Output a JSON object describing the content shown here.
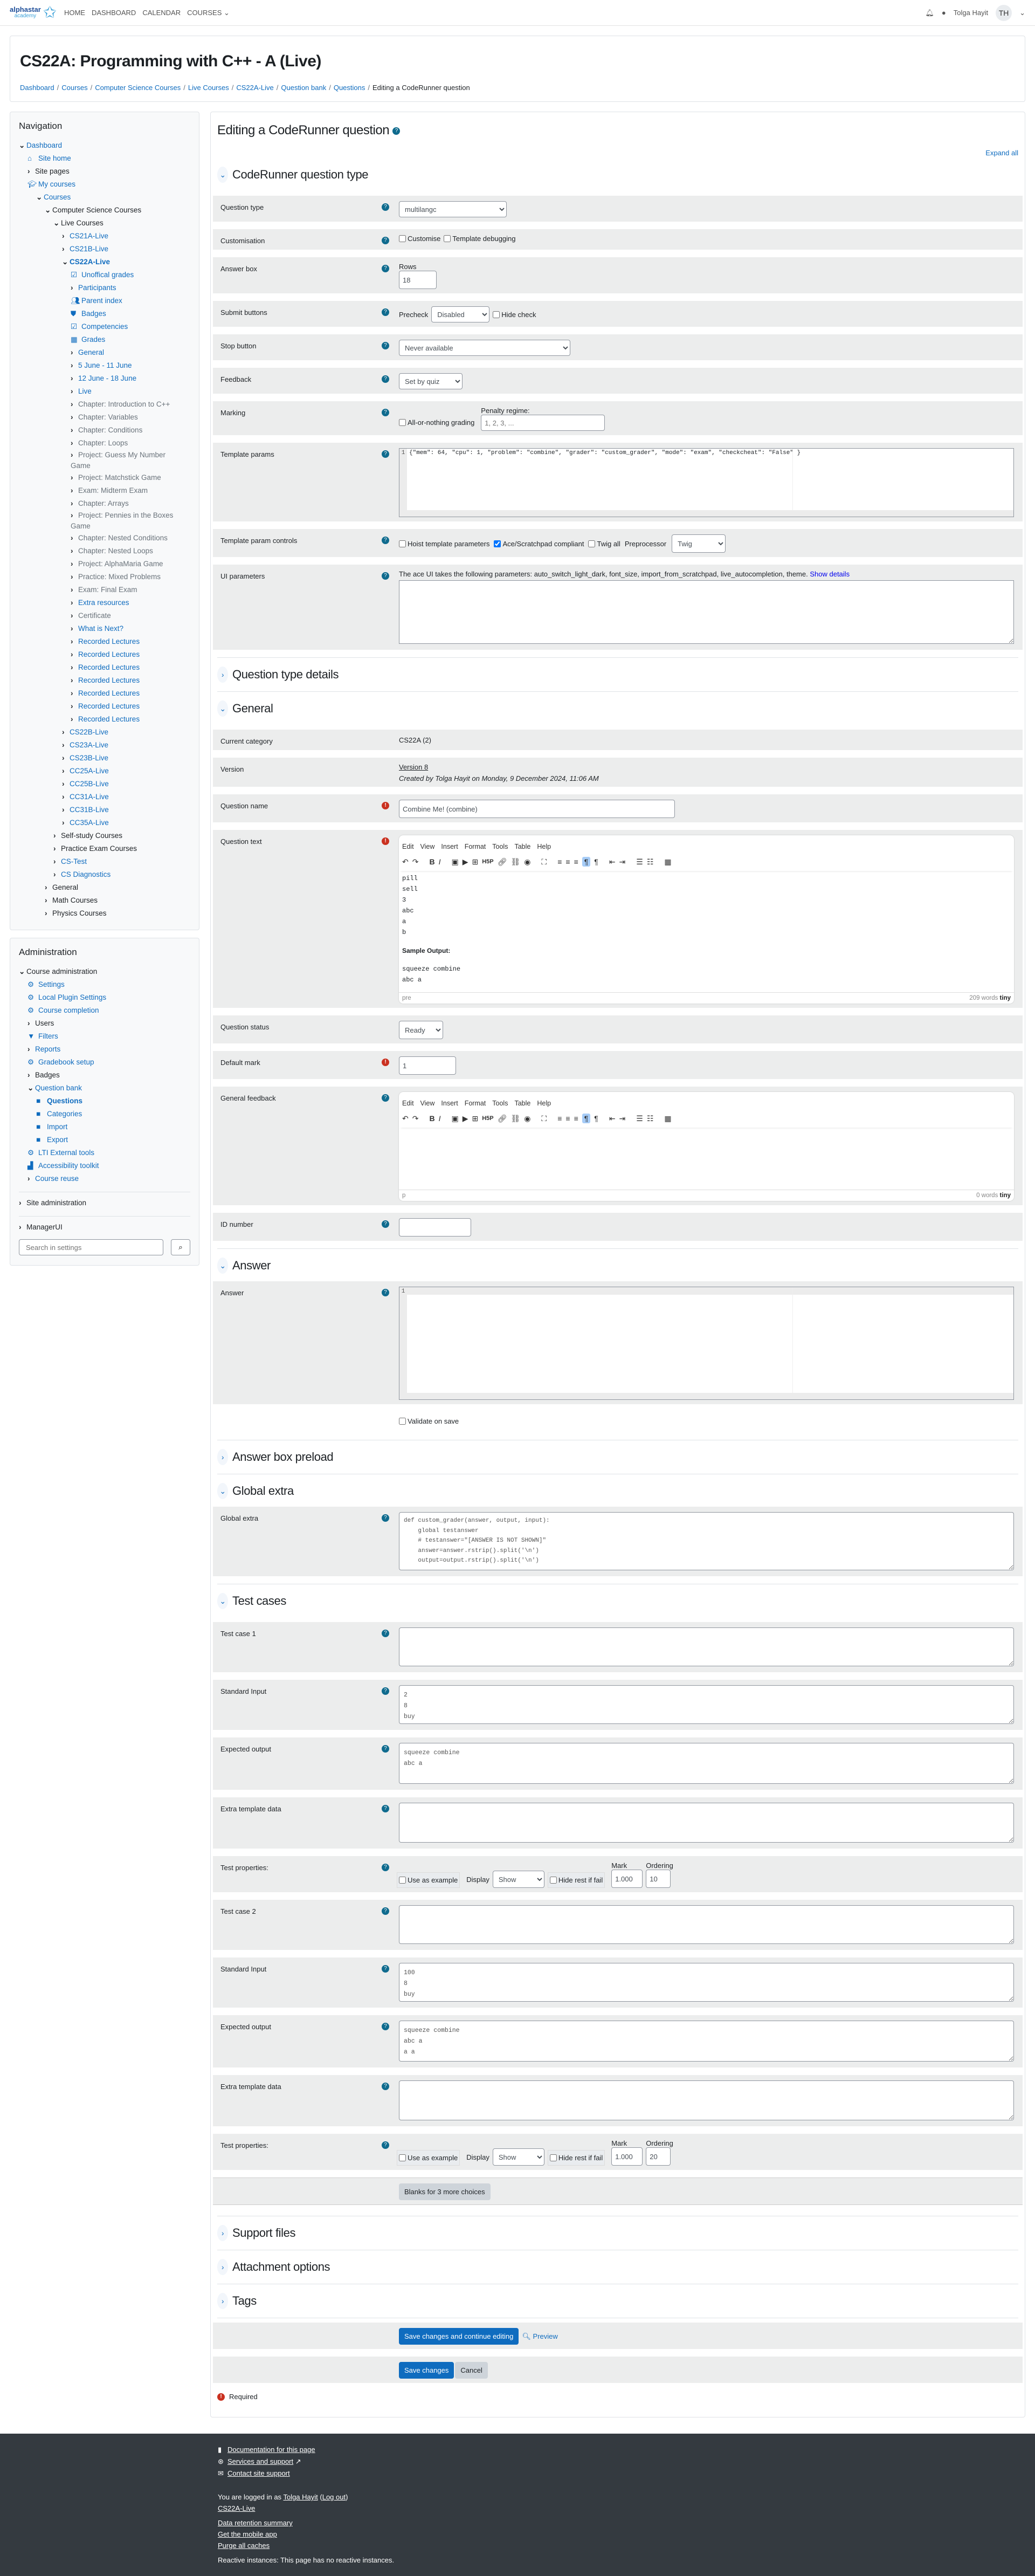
{
  "topnav": {
    "logo_top": "alphastar",
    "logo_bottom": "academy",
    "links": [
      "HOME",
      "DASHBOARD",
      "CALENDAR",
      "COURSES"
    ],
    "user_name": "Tolga Hayit",
    "user_initials": "TH"
  },
  "header": {
    "course_title": "CS22A: Programming with C++ - A (Live)",
    "breadcrumb": [
      "Dashboard",
      "Courses",
      "Computer Science Courses",
      "Live Courses",
      "CS22A-Live",
      "Question bank",
      "Questions",
      "Editing a CodeRunner question"
    ]
  },
  "navigation": {
    "title": "Navigation",
    "items": [
      {
        "label": "Dashboard",
        "indent": 0,
        "caret": "open",
        "style": "b"
      },
      {
        "label": "Site home",
        "indent": 1,
        "icon": "home",
        "style": "b"
      },
      {
        "label": "Site pages",
        "indent": 1,
        "caret": "closed",
        "style": "k"
      },
      {
        "label": "My courses",
        "indent": 1,
        "icon": "grad-cap",
        "style": "b"
      },
      {
        "label": "Courses",
        "indent": 2,
        "caret": "open",
        "style": "b"
      },
      {
        "label": "Computer Science Courses",
        "indent": 3,
        "caret": "open",
        "style": "k"
      },
      {
        "label": "Live Courses",
        "indent": 4,
        "caret": "open",
        "style": "k"
      },
      {
        "label": "CS21A-Live",
        "indent": 5,
        "caret": "closed",
        "style": "b"
      },
      {
        "label": "CS21B-Live",
        "indent": 5,
        "caret": "closed",
        "style": "b"
      },
      {
        "label": "CS22A-Live",
        "indent": 5,
        "caret": "open",
        "style": "b",
        "bold": true
      },
      {
        "label": "Unoffical grades",
        "indent": 6,
        "icon": "checkbox",
        "style": "b"
      },
      {
        "label": "Participants",
        "indent": 6,
        "caret": "closed",
        "style": "b"
      },
      {
        "label": "Parent index",
        "indent": 6,
        "icon": "users",
        "style": "b"
      },
      {
        "label": "Badges",
        "indent": 6,
        "icon": "shield",
        "style": "b"
      },
      {
        "label": "Competencies",
        "indent": 6,
        "icon": "check-square",
        "style": "b"
      },
      {
        "label": "Grades",
        "indent": 6,
        "icon": "table",
        "style": "b"
      },
      {
        "label": "General",
        "indent": 6,
        "caret": "closed",
        "style": "b"
      },
      {
        "label": "5 June - 11 June",
        "indent": 6,
        "caret": "closed",
        "style": "b"
      },
      {
        "label": "12 June - 18 June",
        "indent": 6,
        "caret": "closed",
        "style": "b"
      },
      {
        "label": "Live",
        "indent": 6,
        "caret": "closed",
        "style": "b"
      },
      {
        "label": "Chapter: Introduction to C++",
        "indent": 6,
        "caret": "closed",
        "style": "g"
      },
      {
        "label": "Chapter: Variables",
        "indent": 6,
        "caret": "closed",
        "style": "g"
      },
      {
        "label": "Chapter: Conditions",
        "indent": 6,
        "caret": "closed",
        "style": "g"
      },
      {
        "label": "Chapter: Loops",
        "indent": 6,
        "caret": "closed",
        "style": "g"
      },
      {
        "label": "Project: Guess My Number Game",
        "indent": 6,
        "caret": "closed",
        "style": "g",
        "wrap": true
      },
      {
        "label": "Project: Matchstick Game",
        "indent": 6,
        "caret": "closed",
        "style": "g"
      },
      {
        "label": "Exam: Midterm Exam",
        "indent": 6,
        "caret": "closed",
        "style": "g"
      },
      {
        "label": "Chapter: Arrays",
        "indent": 6,
        "caret": "closed",
        "style": "g"
      },
      {
        "label": "Project: Pennies in the Boxes Game",
        "indent": 6,
        "caret": "closed",
        "style": "g",
        "wrap": true
      },
      {
        "label": "Chapter: Nested Conditions",
        "indent": 6,
        "caret": "closed",
        "style": "g"
      },
      {
        "label": "Chapter: Nested Loops",
        "indent": 6,
        "caret": "closed",
        "style": "g"
      },
      {
        "label": "Project: AlphaMaria Game",
        "indent": 6,
        "caret": "closed",
        "style": "g"
      },
      {
        "label": "Practice: Mixed Problems",
        "indent": 6,
        "caret": "closed",
        "style": "g"
      },
      {
        "label": "Exam: Final Exam",
        "indent": 6,
        "caret": "closed",
        "style": "g"
      },
      {
        "label": "Extra resources",
        "indent": 6,
        "caret": "closed",
        "style": "b"
      },
      {
        "label": "Certificate",
        "indent": 6,
        "caret": "closed",
        "style": "g"
      },
      {
        "label": "What is Next?",
        "indent": 6,
        "caret": "closed",
        "style": "b"
      },
      {
        "label": "Recorded Lectures",
        "indent": 6,
        "caret": "closed",
        "style": "b"
      },
      {
        "label": "Recorded Lectures",
        "indent": 6,
        "caret": "closed",
        "style": "b"
      },
      {
        "label": "Recorded Lectures",
        "indent": 6,
        "caret": "closed",
        "style": "b"
      },
      {
        "label": "Recorded Lectures",
        "indent": 6,
        "caret": "closed",
        "style": "b"
      },
      {
        "label": "Recorded Lectures",
        "indent": 6,
        "caret": "closed",
        "style": "b"
      },
      {
        "label": "Recorded Lectures",
        "indent": 6,
        "caret": "closed",
        "style": "b"
      },
      {
        "label": "Recorded Lectures",
        "indent": 6,
        "caret": "closed",
        "style": "b"
      },
      {
        "label": "CS22B-Live",
        "indent": 5,
        "caret": "closed",
        "style": "b"
      },
      {
        "label": "CS23A-Live",
        "indent": 5,
        "caret": "closed",
        "style": "b"
      },
      {
        "label": "CS23B-Live",
        "indent": 5,
        "caret": "closed",
        "style": "b"
      },
      {
        "label": "CC25A-Live",
        "indent": 5,
        "caret": "closed",
        "style": "b"
      },
      {
        "label": "CC25B-Live",
        "indent": 5,
        "caret": "closed",
        "style": "b"
      },
      {
        "label": "CC31A-Live",
        "indent": 5,
        "caret": "closed",
        "style": "b"
      },
      {
        "label": "CC31B-Live",
        "indent": 5,
        "caret": "closed",
        "style": "b"
      },
      {
        "label": "CC35A-Live",
        "indent": 5,
        "caret": "closed",
        "style": "b"
      },
      {
        "label": "Self-study Courses",
        "indent": 4,
        "caret": "closed",
        "style": "k"
      },
      {
        "label": "Practice Exam Courses",
        "indent": 4,
        "caret": "closed",
        "style": "k"
      },
      {
        "label": "CS-Test",
        "indent": 4,
        "caret": "closed",
        "style": "b"
      },
      {
        "label": "CS Diagnostics",
        "indent": 4,
        "caret": "closed",
        "style": "b"
      },
      {
        "label": "General",
        "indent": 3,
        "caret": "closed",
        "style": "k"
      },
      {
        "label": "Math Courses",
        "indent": 3,
        "caret": "closed",
        "style": "k"
      },
      {
        "label": "Physics Courses",
        "indent": 3,
        "caret": "closed",
        "style": "k"
      }
    ]
  },
  "administration": {
    "title": "Administration",
    "items": [
      {
        "label": "Course administration",
        "indent": 0,
        "caret": "open",
        "style": "k"
      },
      {
        "label": "Settings",
        "indent": 1,
        "icon": "gear",
        "style": "b"
      },
      {
        "label": "Local Plugin Settings",
        "indent": 1,
        "icon": "gear",
        "style": "b"
      },
      {
        "label": "Course completion",
        "indent": 1,
        "icon": "gear",
        "style": "b"
      },
      {
        "label": "Users",
        "indent": 1,
        "caret": "closed",
        "style": "k"
      },
      {
        "label": "Filters",
        "indent": 1,
        "icon": "filter",
        "style": "b"
      },
      {
        "label": "Reports",
        "indent": 1,
        "caret": "closed",
        "style": "b"
      },
      {
        "label": "Gradebook setup",
        "indent": 1,
        "icon": "gear",
        "style": "b"
      },
      {
        "label": "Badges",
        "indent": 1,
        "caret": "closed",
        "style": "k"
      },
      {
        "label": "Question bank",
        "indent": 1,
        "caret": "open",
        "style": "b"
      },
      {
        "label": "Questions",
        "indent": 2,
        "icon": "square",
        "style": "b",
        "bold": true
      },
      {
        "label": "Categories",
        "indent": 2,
        "icon": "square",
        "style": "b"
      },
      {
        "label": "Import",
        "indent": 2,
        "icon": "square",
        "style": "b"
      },
      {
        "label": "Export",
        "indent": 2,
        "icon": "square",
        "style": "b"
      },
      {
        "label": "LTI External tools",
        "indent": 1,
        "icon": "gear",
        "style": "b"
      },
      {
        "label": "Accessibility toolkit",
        "indent": 1,
        "icon": "chart",
        "style": "b"
      },
      {
        "label": "Course reuse",
        "indent": 1,
        "caret": "closed",
        "style": "b"
      }
    ],
    "site_admin": "Site administration",
    "manager_ui": "ManagerUI",
    "search_placeholder": "Search in settings"
  },
  "main": {
    "title": "Editing a CodeRunner question",
    "expand_all": "Expand all",
    "sections": {
      "coderunner": "CodeRunner question type",
      "qtype_details": "Question type details",
      "general": "General",
      "answer": "Answer",
      "preload": "Answer box preload",
      "global_extra": "Global extra",
      "test_cases": "Test cases",
      "support_files": "Support files",
      "attachment": "Attachment options",
      "tags": "Tags"
    },
    "coderunner": {
      "question_type_label": "Question type",
      "question_type_value": "multilangc",
      "customisation_label": "Customisation",
      "customise": "Customise",
      "template_debugging": "Template debugging",
      "answer_box_label": "Answer box",
      "rows_label": "Rows",
      "rows_value": "18",
      "submit_label": "Submit buttons",
      "precheck_label": "Precheck",
      "precheck_value": "Disabled",
      "hide_check": "Hide check",
      "stop_label": "Stop button",
      "stop_value": "Never available",
      "feedback_label": "Feedback",
      "feedback_value": "Set by quiz",
      "marking_label": "Marking",
      "all_or_nothing": "All-or-nothing grading",
      "penalty_label": "Penalty regime:",
      "penalty_placeholder": "1, 2, 3, ...",
      "template_params_label": "Template params",
      "template_params_value": "{\"mem\": 64, \"cpu\": 1, \"problem\": \"combine\", \"grader\": \"custom_grader\", \"mode\": \"exam\", \"checkcheat\": \"False\" }",
      "tpc_label": "Template param controls",
      "hoist": "Hoist template parameters",
      "ace_compliant": "Ace/Scratchpad compliant",
      "ace_checked": true,
      "twig_all": "Twig all",
      "preprocessor_label": "Preprocessor",
      "preprocessor_value": "Twig",
      "ui_params_label": "UI parameters",
      "ui_params_desc": "The ace UI takes the following parameters: auto_switch_light_dark, font_size, import_from_scratchpad, live_autocompletion, theme.",
      "show_details": "Show details"
    },
    "general": {
      "category_label": "Current category",
      "category_value": "CS22A (2)",
      "version_label": "Version",
      "version_value": "Version 8",
      "created_by": "Created by Tolga Hayit on Monday, 9 December 2024, 11:06 AM",
      "name_label": "Question name",
      "name_value": "Combine Me! (combine)",
      "text_label": "Question text",
      "editor_menu": [
        "Edit",
        "View",
        "Insert",
        "Format",
        "Tools",
        "Table",
        "Help"
      ],
      "text_lines": [
        "pill",
        "sell",
        "3",
        "abc",
        "a",
        "b"
      ],
      "sample_output_heading": "Sample Output:",
      "sample_output_lines": [
        "squeeze combine",
        "abc a"
      ],
      "text_status_path": "pre",
      "text_word_count": "209 words",
      "tiny_brand": "tiny",
      "status_label": "Question status",
      "status_value": "Ready",
      "mark_label": "Default mark",
      "mark_value": "1",
      "feedback_label": "General feedback",
      "feedback_status_path": "p",
      "feedback_word_count": "0 words",
      "idnumber_label": "ID number",
      "idnumber_value": ""
    },
    "answer": {
      "label": "Answer",
      "line_number": "1",
      "validate_on_save": "Validate on save"
    },
    "global_extra": {
      "label": "Global extra",
      "code": "def custom_grader(answer, output, input):\n    global testanswer\n    # testanswer=\"[ANSWER IS NOT SHOWN]\"\n    answer=answer.rstrip().split('\\n')\n    output=output.rstrip().split('\\n')"
    },
    "test_cases": [
      {
        "label": "Test case 1",
        "stdin_label": "Standard Input",
        "stdin": "2\n8\nbuy\n.",
        "expected_label": "Expected output",
        "expected": "squeeze combine\nabc a",
        "extra_label": "Extra template data",
        "props_label": "Test properties:",
        "use_as_example": "Use as example",
        "display_label": "Display",
        "display_value": "Show",
        "hide_rest": "Hide rest if fail",
        "mark_label": "Mark",
        "mark_value": "1.000",
        "ordering_label": "Ordering",
        "ordering_value": "10"
      },
      {
        "label": "Test case 2",
        "stdin_label": "Standard Input",
        "stdin": "100\n8\nbuy\n.",
        "expected_label": "Expected output",
        "expected": "squeeze combine\nabc a\na a\n.",
        "extra_label": "Extra template data",
        "props_label": "Test properties:",
        "use_as_example": "Use as example",
        "display_label": "Display",
        "display_value": "Show",
        "hide_rest": "Hide rest if fail",
        "mark_label": "Mark",
        "mark_value": "1.000",
        "ordering_label": "Ordering",
        "ordering_value": "20"
      }
    ],
    "blanks_button": "Blanks for 3 more choices",
    "save_continue": "Save changes and continue editing",
    "preview": "Preview",
    "save": "Save changes",
    "cancel": "Cancel",
    "required": "Required"
  },
  "footer": {
    "documentation": "Documentation for this page",
    "services": "Services and support",
    "contact": "Contact site support",
    "logged_in_prefix": "You are logged in as",
    "logged_in_user": "Tolga Hayit",
    "logout": "Log out",
    "course_link": "CS22A-Live",
    "data_retention": "Data retention summary",
    "mobile_app": "Get the mobile app",
    "purge": "Purge all caches",
    "reactive": "Reactive instances: This page has no reactive instances."
  },
  "colors": {
    "brand": "#0f6cbf",
    "help_icon": "#0f6b8e",
    "required_icon": "#ca3120",
    "footer_bg": "#343a40"
  }
}
